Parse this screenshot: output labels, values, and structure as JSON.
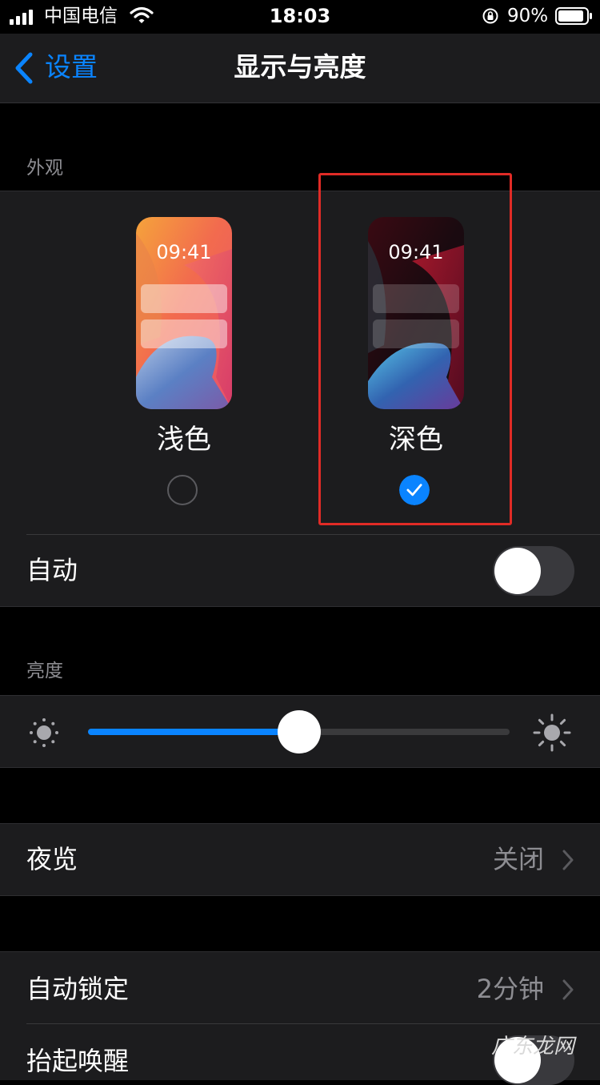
{
  "status_bar": {
    "carrier": "中国电信",
    "time": "18:03",
    "battery": "90%"
  },
  "nav": {
    "back_label": "设置",
    "title": "显示与亮度"
  },
  "appearance": {
    "header": "外观",
    "options": [
      {
        "label": "浅色",
        "preview_time": "09:41",
        "selected": false
      },
      {
        "label": "深色",
        "preview_time": "09:41",
        "selected": true
      }
    ],
    "auto_label": "自动",
    "auto_on": false
  },
  "brightness": {
    "header": "亮度",
    "level": 0.5
  },
  "night_shift": {
    "label": "夜览",
    "value": "关闭"
  },
  "auto_lock": {
    "label": "自动锁定",
    "value": "2分钟"
  },
  "raise_to_wake": {
    "label": "抬起唤醒"
  },
  "watermark": "广东龙网",
  "colors": {
    "accent": "#0a84ff",
    "cell_bg": "#1c1c1e",
    "secondary_text": "#8d8d92",
    "highlight": "#e02b26"
  }
}
